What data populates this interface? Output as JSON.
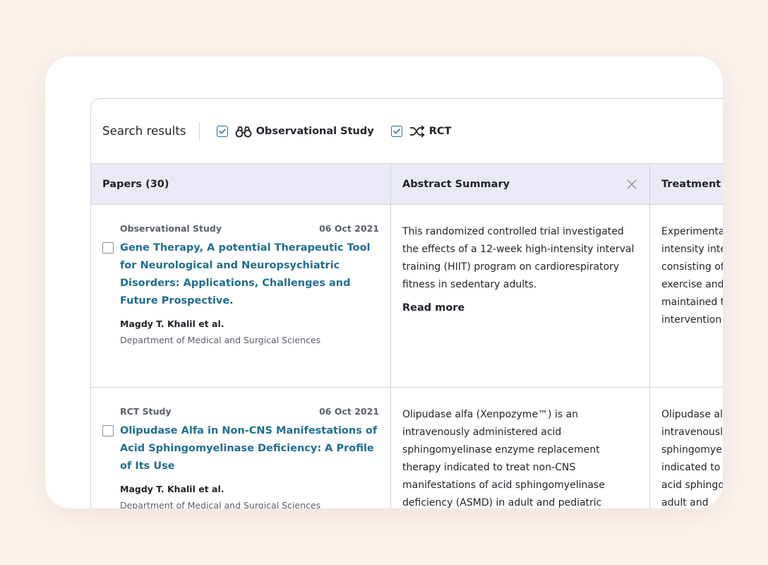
{
  "toolbar": {
    "title": "Search results",
    "filters": [
      {
        "label": "Observational Study",
        "icon": "binoculars-icon",
        "checked": true
      },
      {
        "label": "RCT",
        "icon": "shuffle-icon",
        "checked": true
      }
    ]
  },
  "table": {
    "headers": {
      "papers": "Papers (30)",
      "abstract": "Abstract Summary",
      "treatment": "Treatment"
    },
    "rows": [
      {
        "type": "Observational Study",
        "date": "06 Oct 2021",
        "title": "Gene Therapy, A potential Therapeutic Tool for Neurological and Neuropsychiatric Disorders: Applications, Challenges and Future Prospective.",
        "authors": "Magdy T. Khalil et al.",
        "department": "Department of Medical and Surgical Sciences",
        "abstract": "This randomized controlled trial investigated the effects of a 12-week high-intensity interval training (HIIT) program on cardiorespiratory fitness in sedentary adults.",
        "read_more": "Read more",
        "treatment_lines": [
          "Experimenta",
          "intensity inte",
          "consisting of",
          "exercise and",
          "maintained t",
          "intervention"
        ]
      },
      {
        "type": "RCT Study",
        "date": "06 Oct 2021",
        "title": "Olipudase Alfa in Non-CNS Manifestations of Acid Sphingomyelinase Deficiency: A Profile of Its Use",
        "authors": "Magdy T. Khalil et al.",
        "department": "Department of Medical and Surgical Sciences",
        "abstract": "Olipudase alfa (Xenpozyme™) is an intravenously administered acid sphingomyelinase enzyme replacement therapy indicated to treat non-CNS manifestations of acid sphingomyelinase deficiency (ASMD) in adult and pediatric patients.",
        "treatment_lines": [
          "Olipudase al",
          "intravenousl",
          "sphingomye",
          "indicated to",
          "acid sphingo",
          "adult and"
        ]
      }
    ]
  },
  "colors": {
    "accent": "#1f6e93",
    "checkbox": "#2d6f93",
    "header_bg": "#e9eaf5",
    "page_bg": "#fcf3ef"
  }
}
